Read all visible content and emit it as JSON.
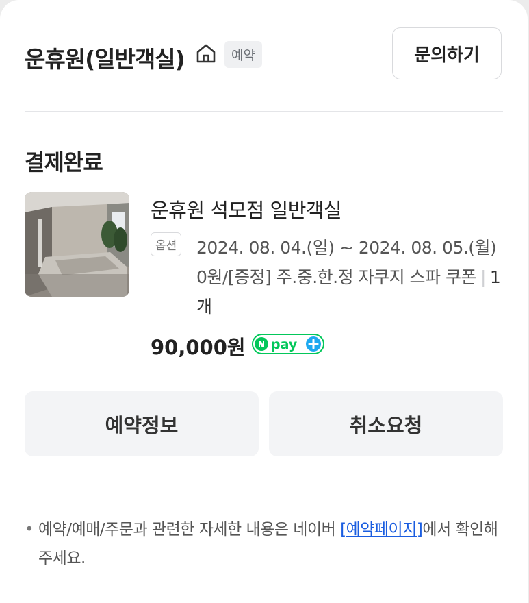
{
  "header": {
    "store_name": "운휴원(일반객실)",
    "badge": "예약",
    "inquiry_label": "문의하기"
  },
  "order": {
    "status": "결제완료",
    "product_name": "운휴원 석모점 일반객실",
    "option_badge": "옵션",
    "option_text": "2024. 08. 04.(일) ~ 2024. 08. 05.(월) 0원/[증정] 주.중.한.정 자쿠지 스파 쿠폰",
    "quantity": "1개",
    "price": "90,000원",
    "payment_method": "pay"
  },
  "actions": {
    "reservation_info": "예약정보",
    "cancel_request": "취소요청"
  },
  "notice": {
    "text_before": "예약/예매/주문과 관련한 자세한 내용은 네이버 ",
    "link": "[예약페이지]",
    "text_after": "에서 확인해주세요."
  },
  "colors": {
    "npay_green": "#03c75a",
    "link_blue": "#1a5de0",
    "button_bg": "#f3f4f6"
  },
  "icons": [
    "home-icon",
    "npay-plus-logo"
  ]
}
